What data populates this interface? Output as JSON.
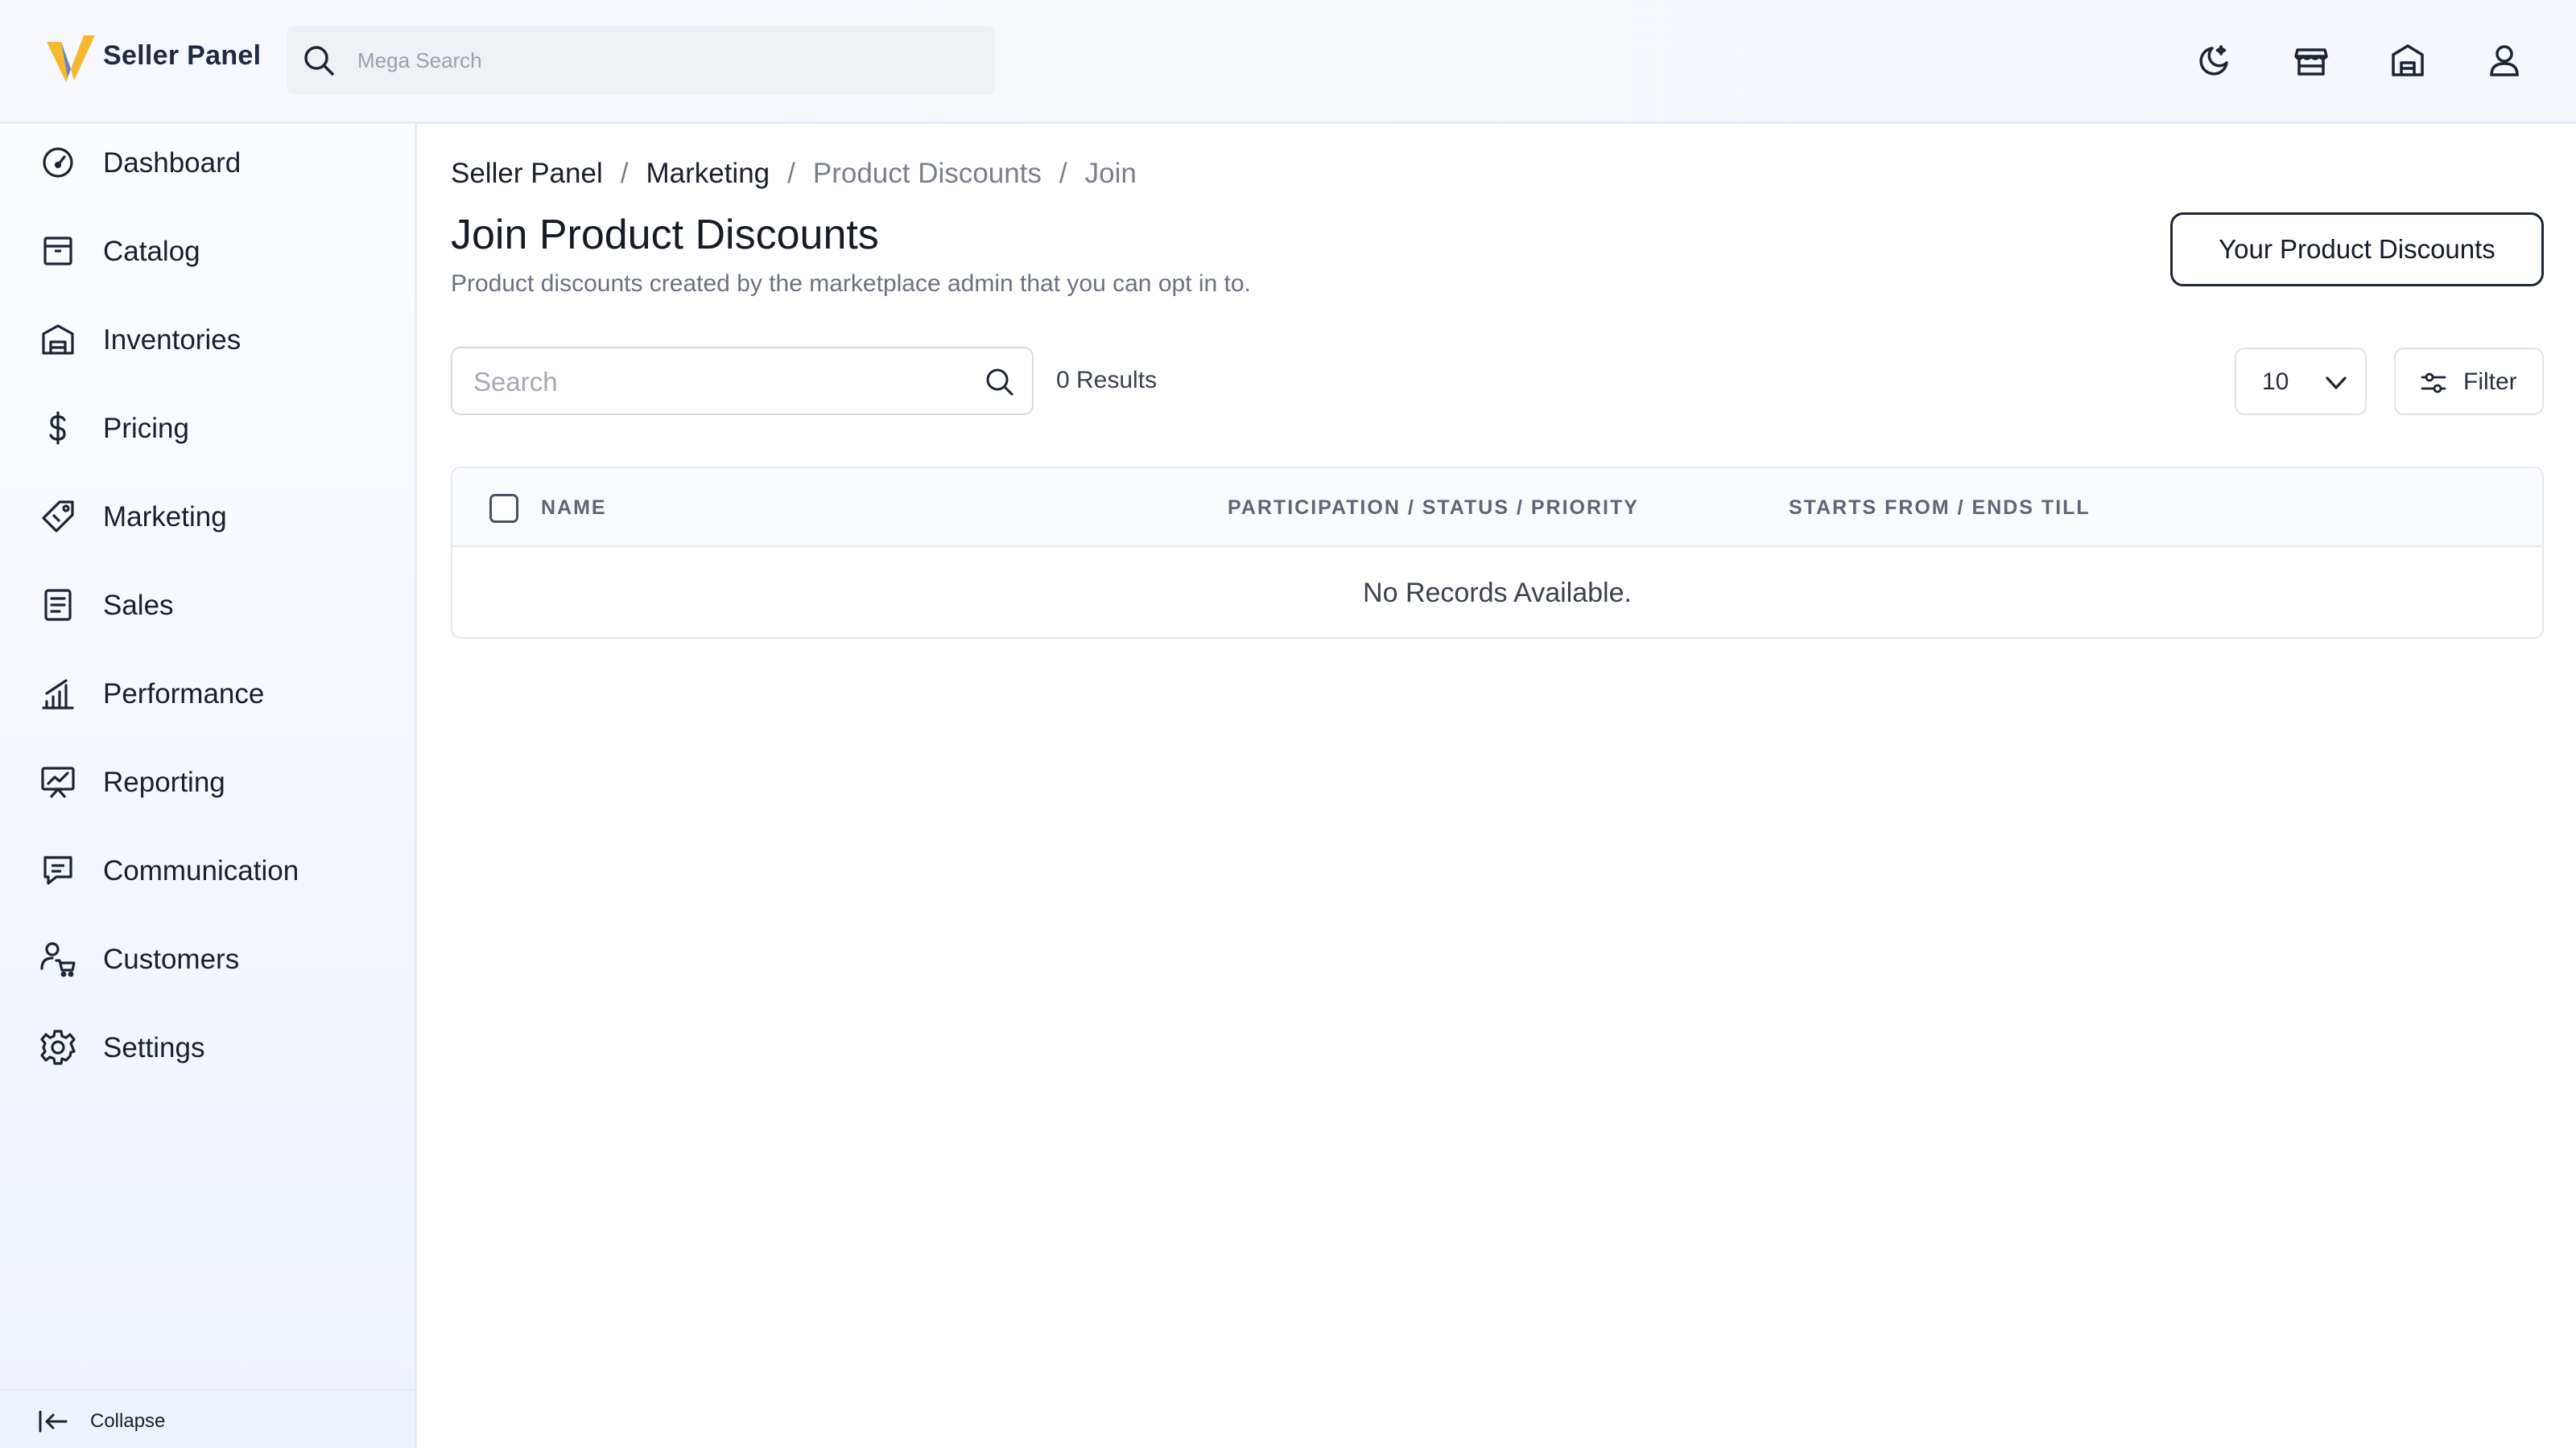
{
  "header": {
    "brand": "Seller Panel",
    "search_placeholder": "Mega Search",
    "icons": [
      "moon-icon",
      "store-icon",
      "warehouse-icon",
      "user-icon"
    ]
  },
  "sidebar": {
    "items": [
      {
        "label": "Dashboard",
        "icon": "gauge-icon"
      },
      {
        "label": "Catalog",
        "icon": "box-icon"
      },
      {
        "label": "Inventories",
        "icon": "warehouse-icon"
      },
      {
        "label": "Pricing",
        "icon": "dollar-icon"
      },
      {
        "label": "Marketing",
        "icon": "tag-icon"
      },
      {
        "label": "Sales",
        "icon": "receipt-icon"
      },
      {
        "label": "Performance",
        "icon": "bar-chart-icon"
      },
      {
        "label": "Reporting",
        "icon": "presentation-icon"
      },
      {
        "label": "Communication",
        "icon": "message-icon"
      },
      {
        "label": "Customers",
        "icon": "customer-cart-icon"
      },
      {
        "label": "Settings",
        "icon": "gear-icon"
      }
    ],
    "collapse_label": "Collapse"
  },
  "breadcrumb": [
    "Seller Panel",
    "Marketing",
    "Product Discounts",
    "Join"
  ],
  "page": {
    "title": "Join Product Discounts",
    "subtitle": "Product discounts created by the marketplace admin that you can opt in to.",
    "primary_button": "Your Product Discounts"
  },
  "toolbar": {
    "search_placeholder": "Search",
    "results": "0 Results",
    "page_size": "10",
    "filter_label": "Filter"
  },
  "table": {
    "columns": [
      "NAME",
      "PARTICIPATION / STATUS / PRIORITY",
      "STARTS FROM / ENDS TILL"
    ],
    "empty_message": "No Records Available."
  },
  "colors": {
    "logo_yellow": "#F5B82E",
    "logo_blue": "#4A7BD8",
    "text_primary": "#151A26",
    "text_muted": "#6B7180"
  }
}
